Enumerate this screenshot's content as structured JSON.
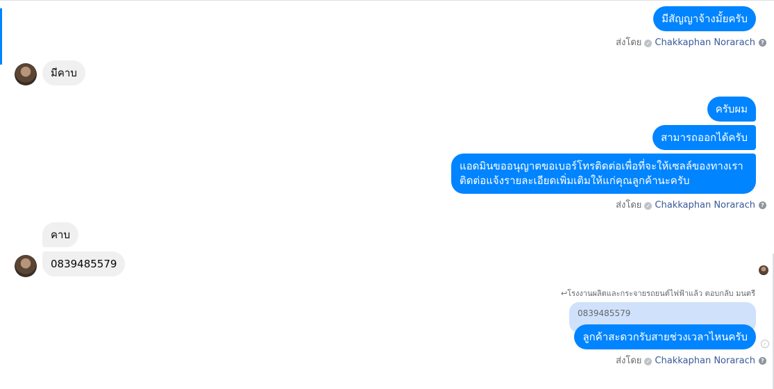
{
  "messages": {
    "out1": "มีสัญญาจ้างมั้ยครับ",
    "in1": "มีคาบ",
    "out2": "ครับผม",
    "out3": "สามารถออกได้ครับ",
    "out4_line1": "แอดมินขออนุญาตขอเบอร์โทรติดต่อเพื่อที่จะให้เซลล์ของทางเรา",
    "out4_line2": "ติดต่อแจ้งรายละเอียดเพิ่มเติมให้แก่คุณลูกค้านะครับ",
    "in2": "คาบ",
    "in3": "0839485579",
    "out5": "ลูกค้าสะดวกรับสายช่วงเวลาไหนครับ"
  },
  "sent_by": {
    "prefix": "ส่งโดย",
    "name": "Chakkaphan Norarach",
    "check_glyph": "✓",
    "help_glyph": "?"
  },
  "reply": {
    "label": "โรงงานผลิตและกระจายรถยนต์ไฟฟ้าแล้ว ตอบกลับ มนตรี",
    "quoted": "0839485579"
  },
  "colors": {
    "outgoing": "#0084ff",
    "incoming": "#f0f0f0",
    "link": "#385898"
  }
}
